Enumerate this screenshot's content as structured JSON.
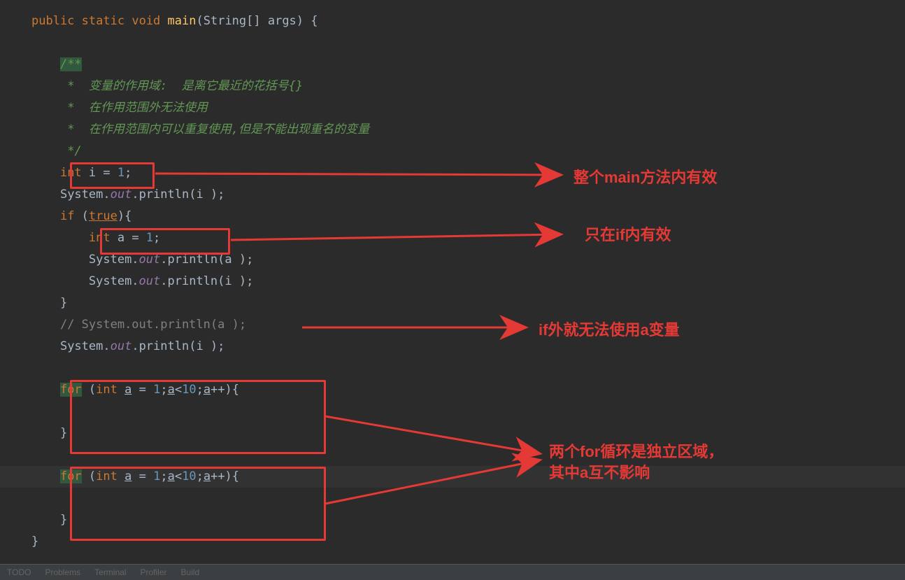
{
  "code": {
    "l1_public": "public",
    "l1_static": "static",
    "l1_void": "void",
    "l1_main": "main",
    "l1_sig": "(String[] args) {",
    "doc_open": "/**",
    "doc1_star": " *  ",
    "doc1_txt": "变量的作用域:  是离它最近的花括号{}",
    "doc2_star": " *  ",
    "doc2_txt": "在作用范围外无法使用",
    "doc3_star": " *  ",
    "doc3_txt": "在作用范围内可以重复使用,但是不能出现重名的变量",
    "doc_close": " */",
    "l_int_i": "int",
    "l_int_i_rest": " i = ",
    "num1": "1",
    "semi": ";",
    "l_sysout": "System.",
    "l_out": "out",
    "l_println": ".println(i );",
    "l_if": "if",
    "l_if_paren": " (",
    "l_true": "true",
    "l_if_close": "){",
    "l_int_a": "int",
    "l_int_a_rest": " a = ",
    "l_println_a": ".println(a );",
    "l_println_i2": ".println(i );",
    "l_brace": "}",
    "l_comment_sysout": "// System.out.println(a );",
    "l_for": "for",
    "l_for_open": " (",
    "l_for_int": "int",
    "l_for_a": " ",
    "l_for_a_u": "a",
    "l_for_eq": " = ",
    "l_for_semi": ";",
    "l_for_cond_a": "a",
    "l_for_cond": "<",
    "l_for_10": "10",
    "l_for_inc_a": "a",
    "l_for_inc": "++){"
  },
  "annotations": {
    "a1": "整个main方法内有效",
    "a2": "只在if内有效",
    "a3": "if外就无法使用a变量",
    "a4_line1": "两个for循环是独立区域，",
    "a4_line2": "其中a互不影响"
  }
}
